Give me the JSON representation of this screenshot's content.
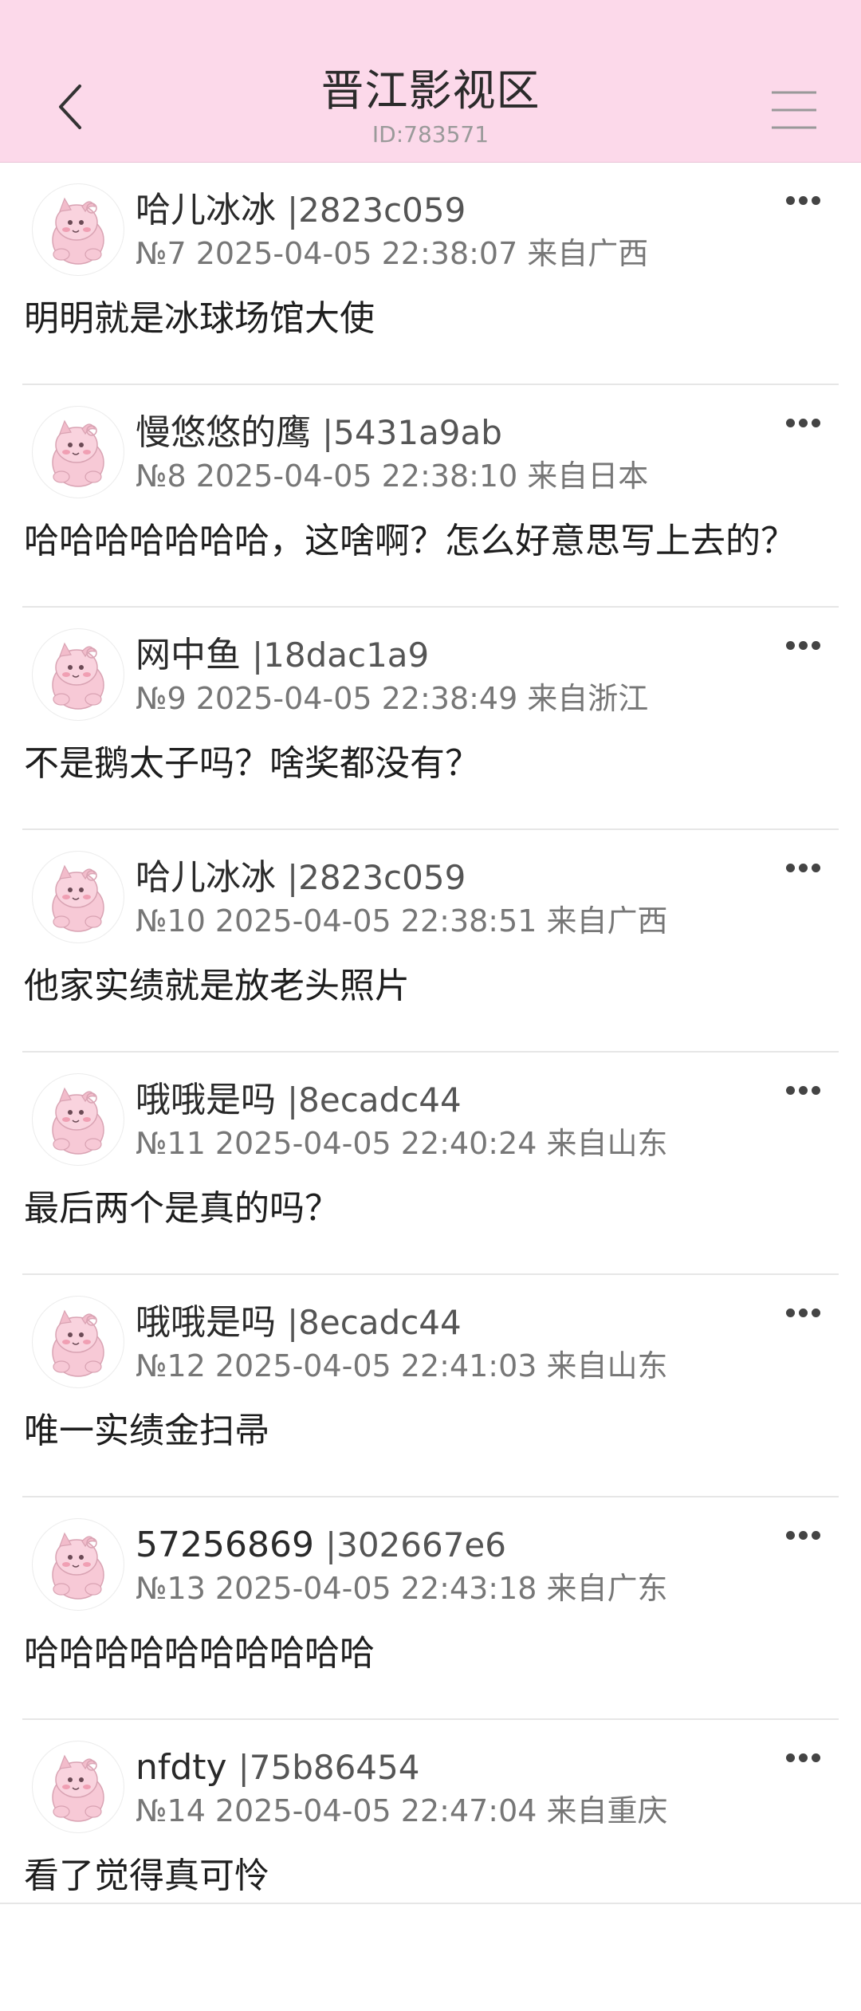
{
  "header": {
    "title": "晋江影视区",
    "subtitle": "ID:783571"
  },
  "icons": {
    "back": "chevron-left-icon",
    "menu": "hamburger-menu-icon",
    "more": "more-dots-icon"
  },
  "colors": {
    "header_bg": "#fcd9ea",
    "divider": "#e6e6e6"
  },
  "posts": [
    {
      "name": "哈儿冰冰",
      "uid": "|2823c059",
      "no": "№7",
      "time": "2025-04-05 22:38:07",
      "loc": "来自广西",
      "content": "明明就是冰球场馆大使"
    },
    {
      "name": "慢悠悠的鹰",
      "uid": "|5431a9ab",
      "no": "№8",
      "time": "2025-04-05 22:38:10",
      "loc": "来自日本",
      "content": "哈哈哈哈哈哈哈，这啥啊？怎么好意思写上去的？"
    },
    {
      "name": "网中鱼",
      "uid": "|18dac1a9",
      "no": "№9",
      "time": "2025-04-05 22:38:49",
      "loc": "来自浙江",
      "content": "不是鹅太子吗？啥奖都没有？"
    },
    {
      "name": "哈儿冰冰",
      "uid": "|2823c059",
      "no": "№10",
      "time": "2025-04-05 22:38:51",
      "loc": "来自广西",
      "content": "他家实绩就是放老头照片"
    },
    {
      "name": "哦哦是吗",
      "uid": "|8ecadc44",
      "no": "№11",
      "time": "2025-04-05 22:40:24",
      "loc": "来自山东",
      "content": "最后两个是真的吗？"
    },
    {
      "name": "哦哦是吗",
      "uid": "|8ecadc44",
      "no": "№12",
      "time": "2025-04-05 22:41:03",
      "loc": "来自山东",
      "content": "唯一实绩金扫帚"
    },
    {
      "name": "57256869",
      "uid": "|302667e6",
      "no": "№13",
      "time": "2025-04-05 22:43:18",
      "loc": "来自广东",
      "content": "哈哈哈哈哈哈哈哈哈哈"
    },
    {
      "name": "nfdty",
      "uid": "|75b86454",
      "no": "№14",
      "time": "2025-04-05 22:47:04",
      "loc": "来自重庆",
      "content": "看了觉得真可怜"
    }
  ]
}
